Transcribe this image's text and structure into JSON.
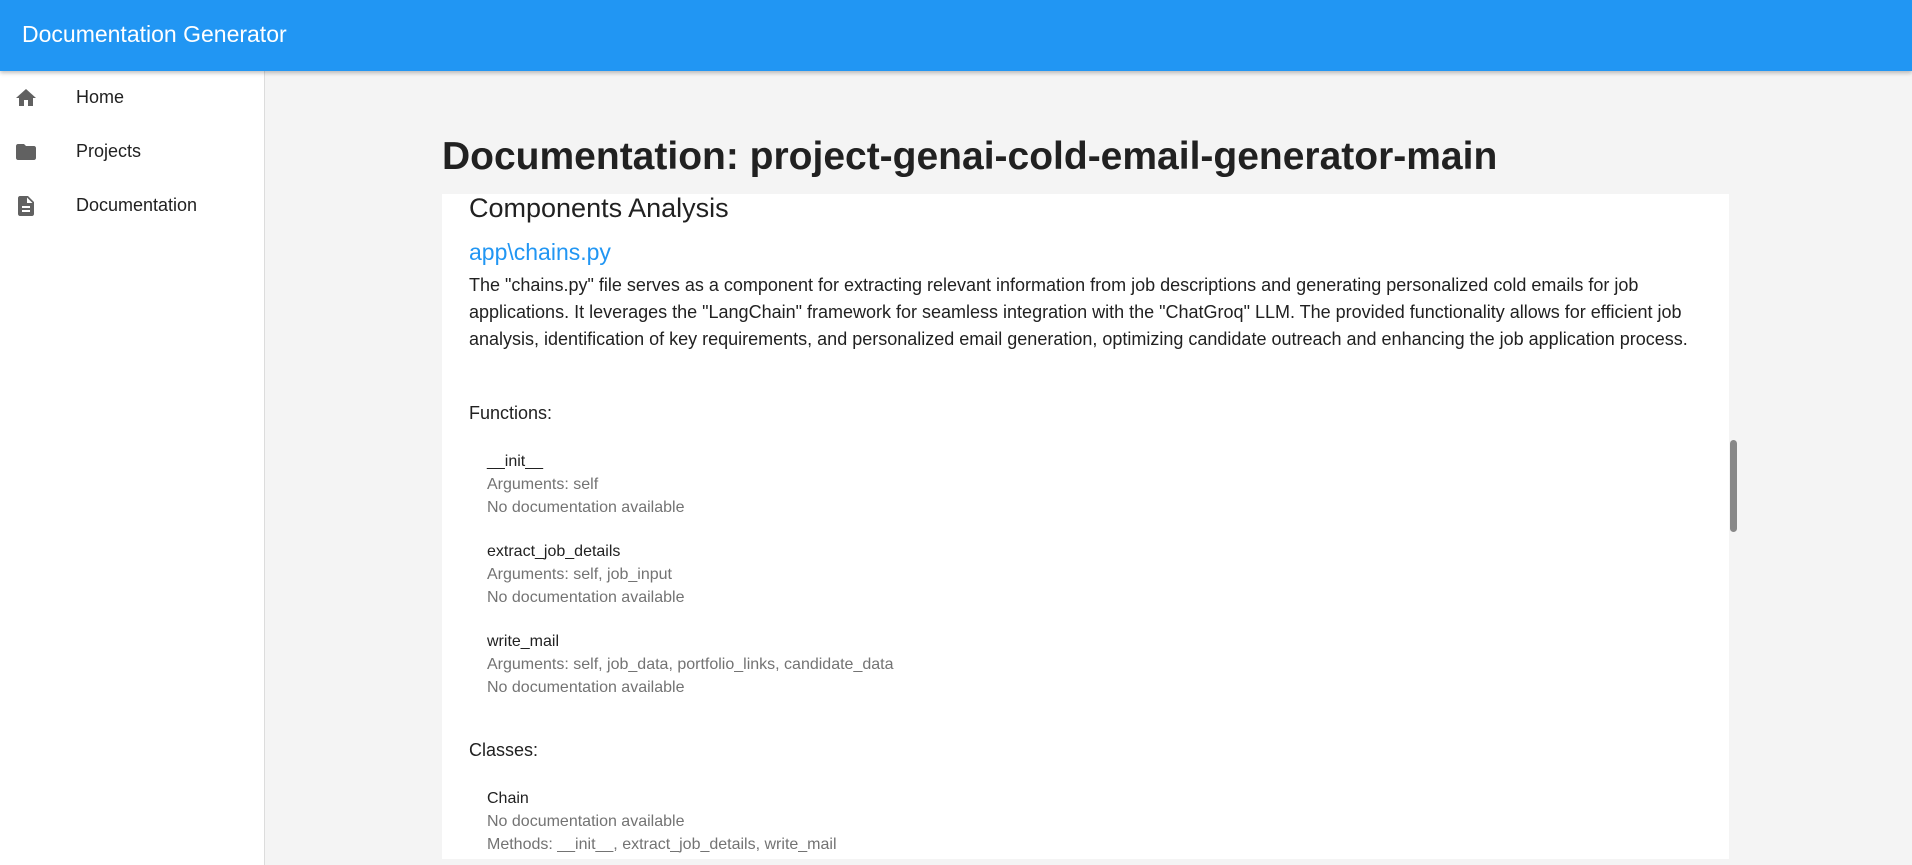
{
  "app": {
    "title": "Documentation Generator"
  },
  "sidebar": {
    "items": [
      {
        "label": "Home",
        "icon": "home-icon"
      },
      {
        "label": "Projects",
        "icon": "folder-icon"
      },
      {
        "label": "Documentation",
        "icon": "document-icon"
      }
    ]
  },
  "page": {
    "title": "Documentation: project-genai-cold-email-generator-main"
  },
  "components": {
    "title": "Components Analysis",
    "file": {
      "name": "app\\chains.py",
      "description": "The \"chains.py\" file serves as a component for extracting relevant information from job descriptions and generating personalized cold emails for job applications. It leverages the \"LangChain\" framework for seamless integration with the \"ChatGroq\" LLM. The provided functionality allows for efficient job analysis, identification of key requirements, and personalized email generation, optimizing candidate outreach and enhancing the job application process.",
      "functions_label": "Functions:",
      "functions": [
        {
          "name": "__init__",
          "arguments": "Arguments: self",
          "doc": "No documentation available"
        },
        {
          "name": "extract_job_details",
          "arguments": "Arguments: self, job_input",
          "doc": "No documentation available"
        },
        {
          "name": "write_mail",
          "arguments": "Arguments: self, job_data, portfolio_links, candidate_data",
          "doc": "No documentation available"
        }
      ],
      "classes_label": "Classes:",
      "classes": [
        {
          "name": "Chain",
          "doc": "No documentation available",
          "methods": "Methods: __init__, extract_job_details, write_mail"
        }
      ]
    }
  },
  "colors": {
    "appbar": "#2196f3",
    "link": "#2196f3",
    "muted_text": "#737373"
  }
}
